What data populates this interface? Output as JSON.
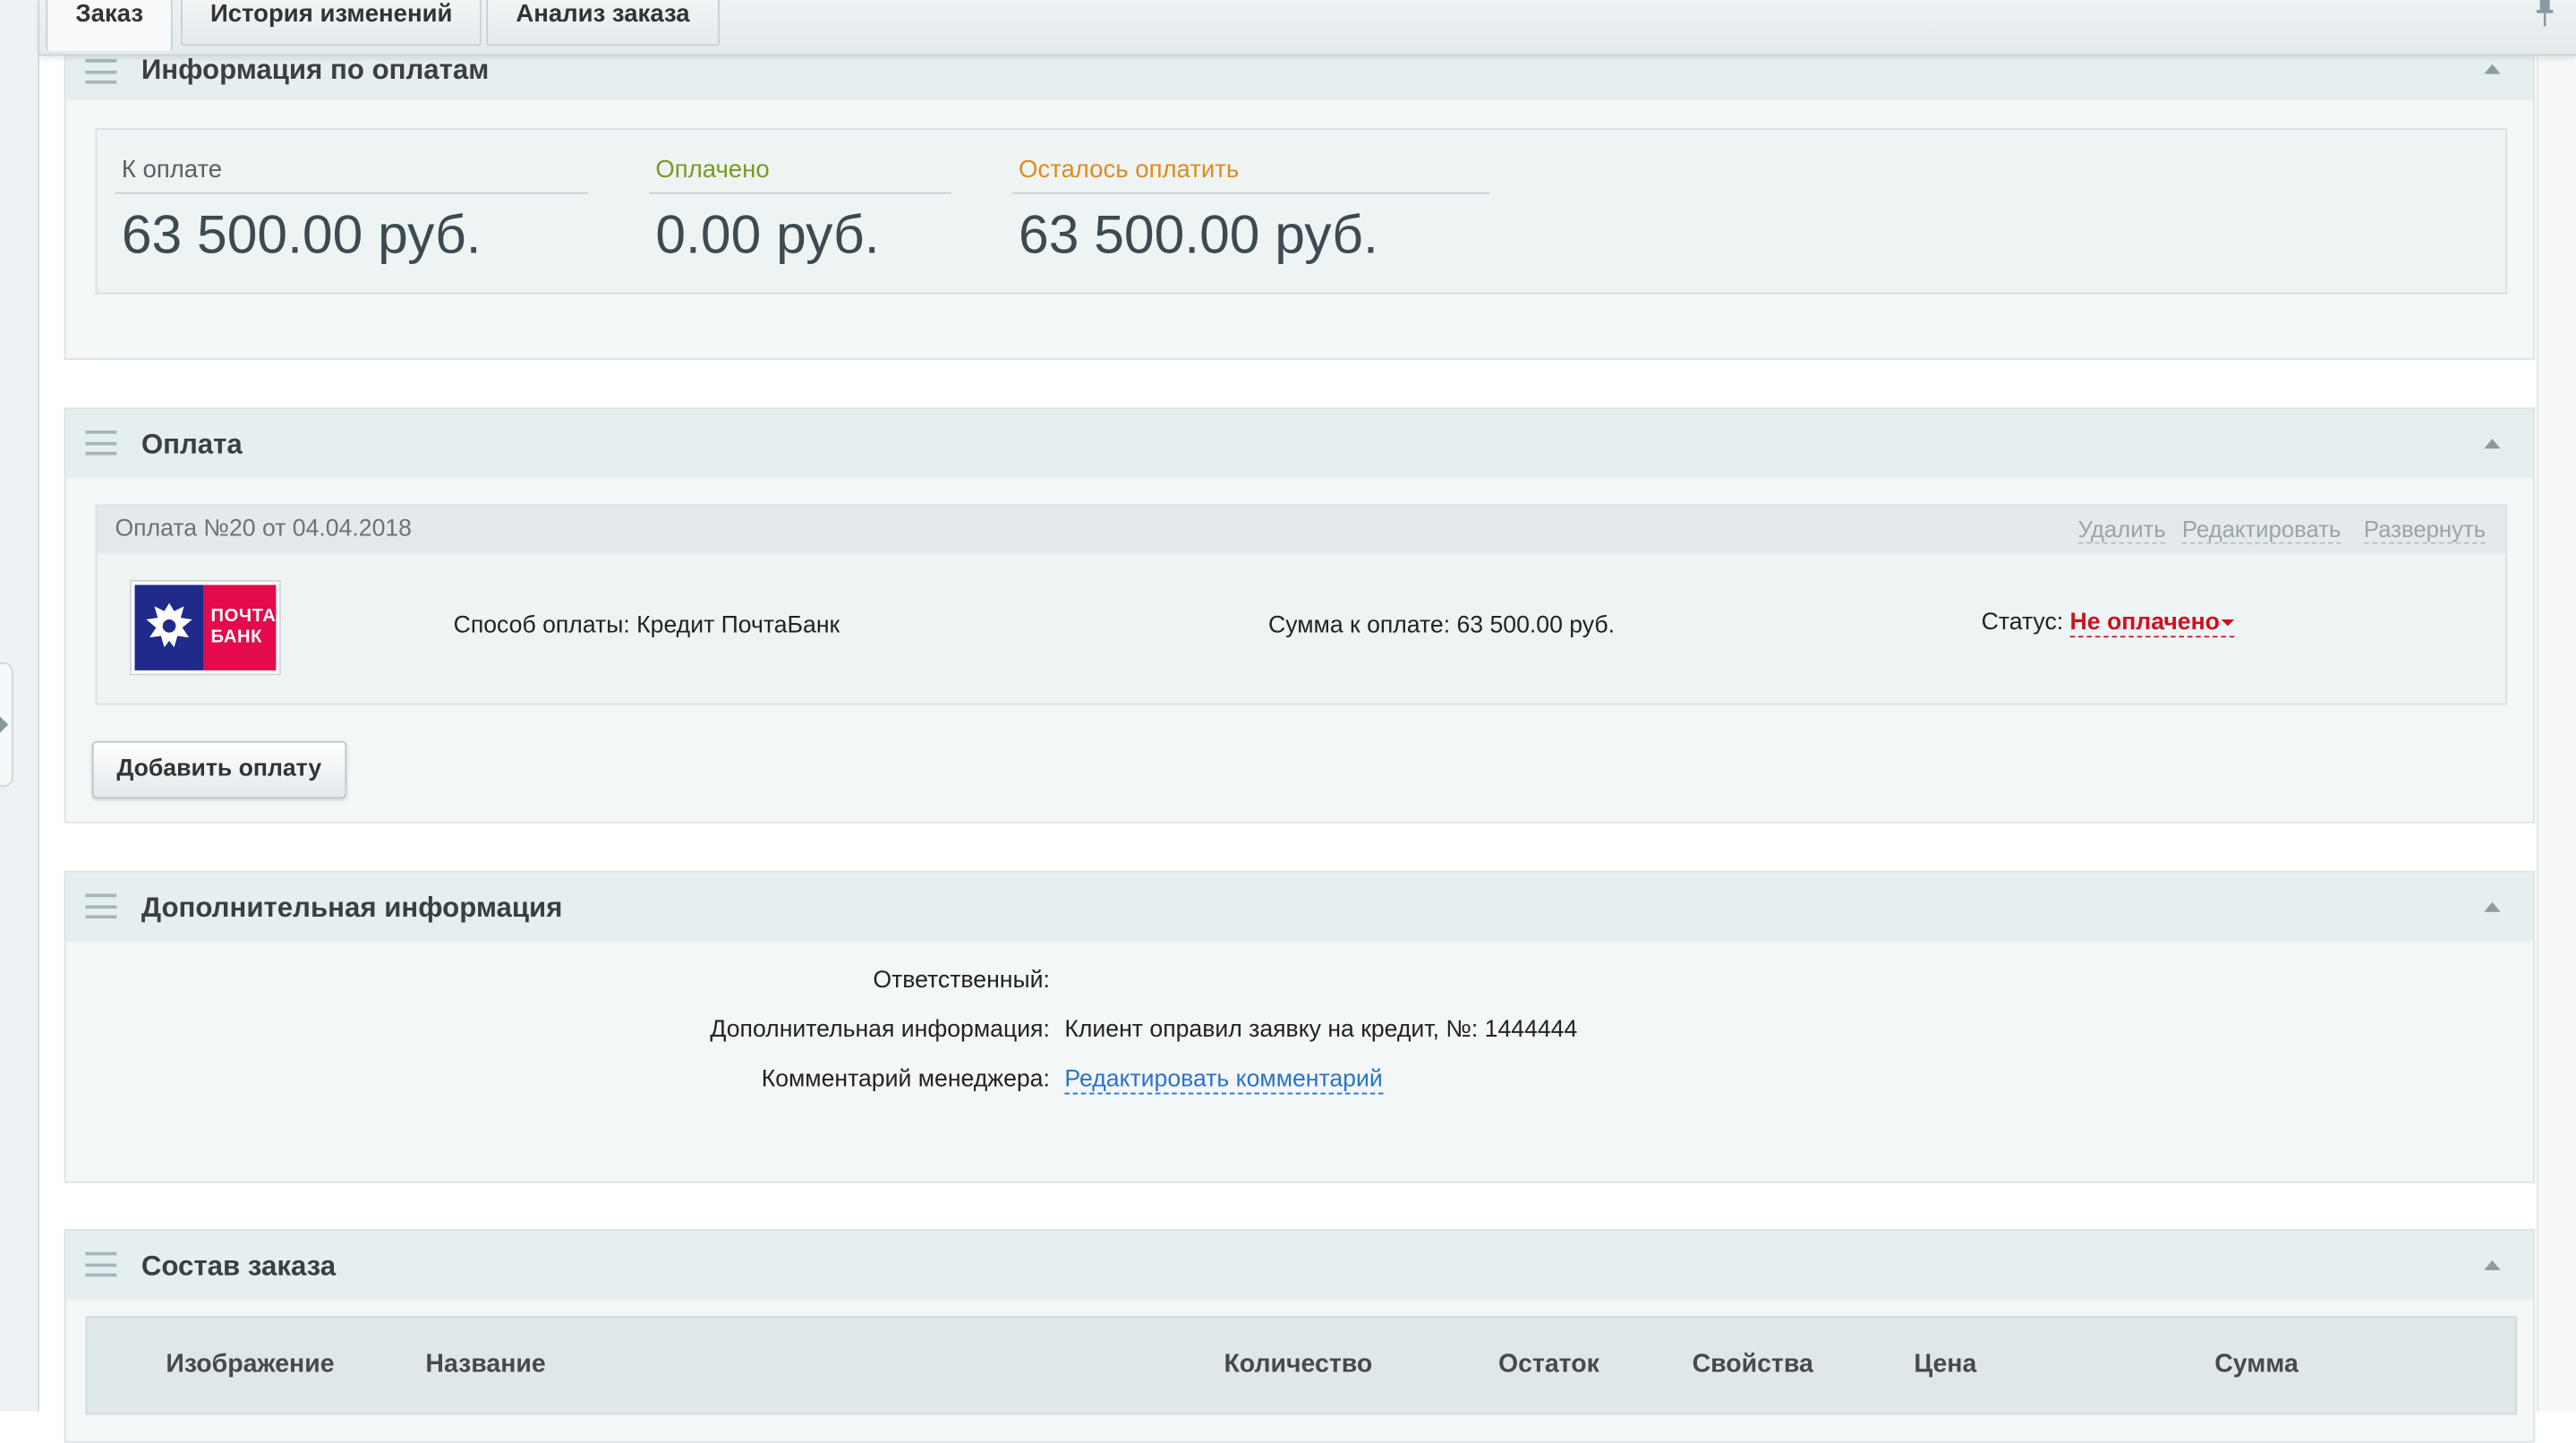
{
  "tabs": [
    {
      "label": "Заказ",
      "active": true
    },
    {
      "label": "История изменений",
      "active": false
    },
    {
      "label": "Анализ заказа",
      "active": false
    }
  ],
  "payments_info": {
    "title": "Информация по оплатам",
    "to_pay": {
      "label": "К оплате",
      "value": "63 500.00 руб.",
      "color": "#5a5f63"
    },
    "paid": {
      "label": "Оплачено",
      "value": "0.00 руб.",
      "color": "#7a9a1e"
    },
    "remaining": {
      "label": "Осталось оплатить",
      "value": "63 500.00 руб.",
      "color": "#e08a1e"
    }
  },
  "payment": {
    "title": "Оплата",
    "card": {
      "header": "Оплата №20 от 04.04.2018",
      "actions": [
        "Удалить",
        "Редактировать",
        "Развернуть"
      ],
      "logo_text_line1": "ПОЧТА",
      "logo_text_line2": "БАНК",
      "method": "Способ оплаты: Кредит ПочтаБанк",
      "amount": "Сумма к оплате: 63 500.00 руб.",
      "status_label": "Статус:",
      "status_value": "Не оплачено"
    },
    "add_button": "Добавить оплату"
  },
  "additional_info": {
    "title": "Дополнительная информация",
    "responsible_label": "Ответственный:",
    "responsible_value": "",
    "info_label": "Дополнительная информация:",
    "info_value": "Клиент оправил заявку на кредит, №: 1444444",
    "comment_label": "Комментарий менеджера:",
    "comment_link": "Редактировать комментарий"
  },
  "order_composition": {
    "title": "Состав заказа",
    "columns": [
      "Изображение",
      "Название",
      "Количество",
      "Остаток",
      "Свойства",
      "Цена",
      "Сумма"
    ]
  }
}
